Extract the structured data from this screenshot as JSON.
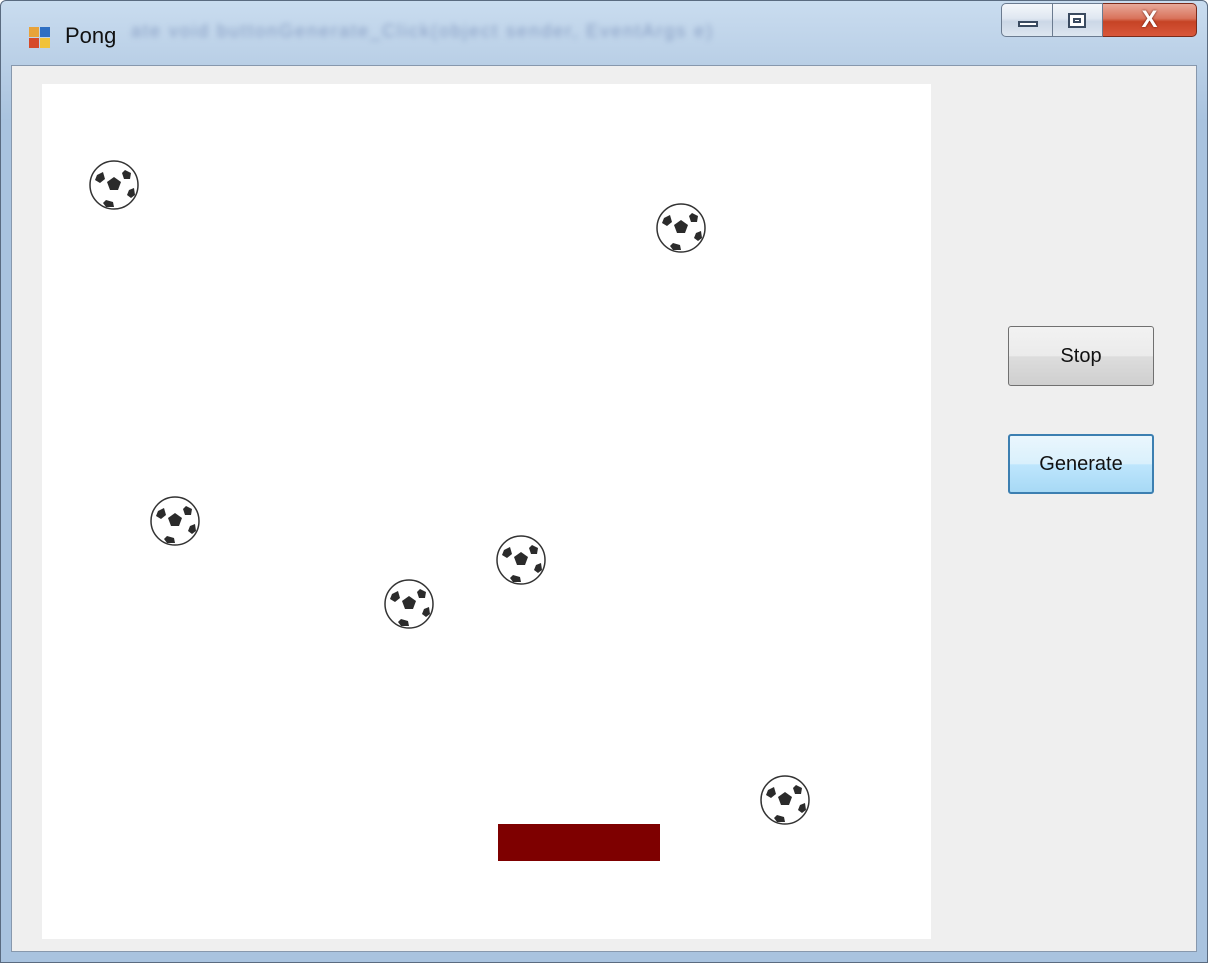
{
  "window": {
    "title": "Pong",
    "blurred_background_text": "ate void buttonGenerate_Click(object sender, EventArgs e)",
    "close_label": "X"
  },
  "buttons": {
    "stop_label": "Stop",
    "generate_label": "Generate"
  },
  "colors": {
    "paddle": "#7e0000",
    "court": "#ffffff",
    "panel": "#efefef",
    "focus_border": "#3c7fb1"
  },
  "icons": {
    "app": "winforms-app-icon",
    "ball": "soccer-ball-icon",
    "minimize": "minimize-icon",
    "maximize": "restore-icon",
    "close": "close-icon"
  }
}
